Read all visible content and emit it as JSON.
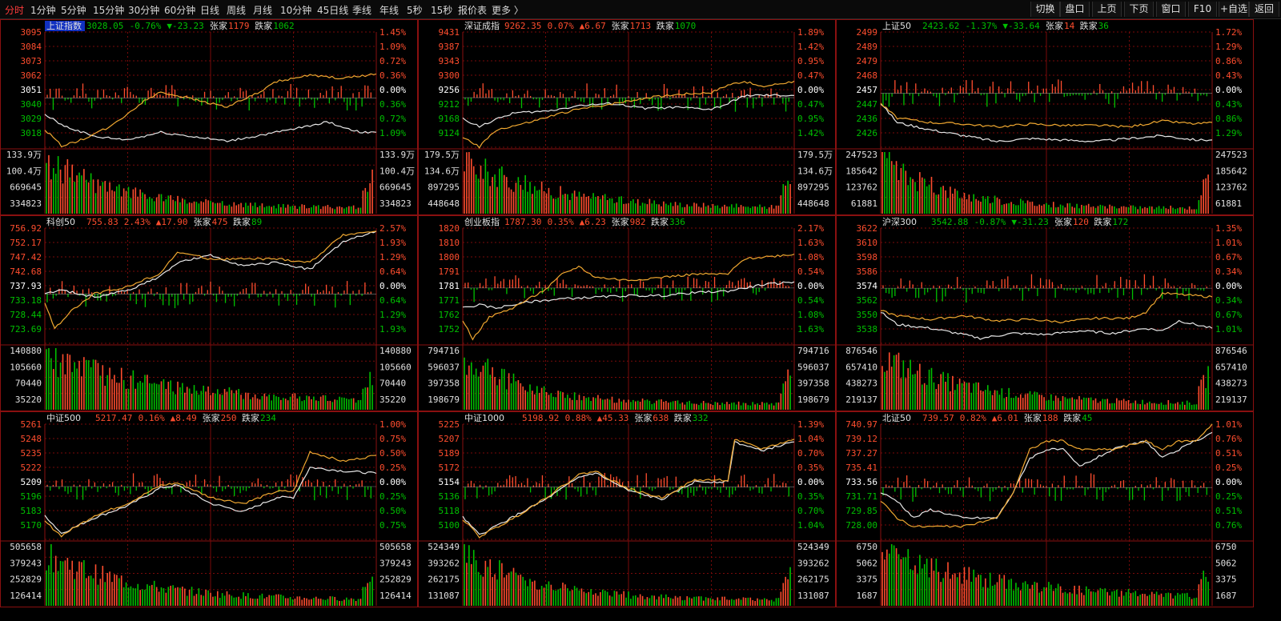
{
  "toolbar": {
    "tabs": [
      "分时",
      "1分钟",
      "5分钟",
      "15分钟",
      "30分钟",
      "60分钟",
      "日线",
      "周线",
      "月线",
      "10分钟",
      "45日线",
      "季线",
      "年线",
      "5秒",
      "15秒",
      "报价表",
      "更多 〉"
    ],
    "active_tab": "分时",
    "right_buttons": [
      "切换",
      "盘口",
      "上页",
      "下页",
      "窗口",
      "F10",
      "+自选",
      "返回"
    ]
  },
  "colors": {
    "up": "#ff4d2e",
    "down": "#00c000",
    "white_line": "#e8e8e8",
    "yellow_line": "#f0a830",
    "grid": "#7a0a0a",
    "neutral": "#ffffff"
  },
  "chart_data": [
    {
      "type": "line",
      "name": "上证指数",
      "highlight_name": true,
      "header": {
        "price": "3028.05",
        "pct": "-0.76%",
        "change": "▼-23.23",
        "rise_label": "张家",
        "rise": "1179",
        "fall_label": "跌家",
        "fall": "1062"
      },
      "price_ticks": [
        "3095",
        "3084",
        "3073",
        "3062",
        "3051",
        "3040",
        "3029",
        "3018"
      ],
      "pct_ticks": [
        "1.45%",
        "1.09%",
        "0.72%",
        "0.36%",
        "0.00%",
        "0.36%",
        "0.72%",
        "1.09%"
      ],
      "vol_ticks": [
        "133.9万",
        "100.4万",
        "669645",
        "334823"
      ],
      "ylim": [
        3018,
        3095
      ],
      "prev_close": 3051,
      "white_x": [
        0,
        5,
        15,
        25,
        35,
        45,
        55,
        65,
        75,
        85,
        95,
        100
      ],
      "white_y": [
        3040,
        3033,
        3025,
        3023,
        3028,
        3025,
        3022,
        3026,
        3030,
        3035,
        3028,
        3028
      ],
      "yellow_x": [
        0,
        5,
        10,
        20,
        30,
        35,
        45,
        55,
        65,
        70,
        80,
        90,
        100
      ],
      "yellow_y": [
        3030,
        3019,
        3022,
        3032,
        3049,
        3055,
        3050,
        3045,
        3055,
        3062,
        3066,
        3064,
        3067
      ],
      "bars_seed": 1,
      "vol_decay": 0.035
    },
    {
      "type": "line",
      "name": "深证成指",
      "header": {
        "price": "9262.35",
        "pct": "0.07%",
        "change": "▲6.67",
        "rise_label": "张家",
        "rise": "1713",
        "fall_label": "跌家",
        "fall": "1070"
      },
      "price_ticks": [
        "9431",
        "9387",
        "9343",
        "9300",
        "9256",
        "9212",
        "9168",
        "9124"
      ],
      "pct_ticks": [
        "1.89%",
        "1.42%",
        "0.95%",
        "0.47%",
        "0.00%",
        "0.47%",
        "0.95%",
        "1.42%"
      ],
      "vol_ticks": [
        "179.5万",
        "134.6万",
        "897295",
        "448648"
      ],
      "ylim": [
        9124,
        9431
      ],
      "prev_close": 9256,
      "white_x": [
        0,
        5,
        15,
        25,
        35,
        45,
        55,
        65,
        75,
        80,
        85,
        100
      ],
      "white_y": [
        9200,
        9180,
        9215,
        9220,
        9235,
        9240,
        9228,
        9230,
        9225,
        9240,
        9262,
        9262
      ],
      "yellow_x": [
        0,
        5,
        10,
        20,
        30,
        35,
        45,
        55,
        65,
        75,
        80,
        85,
        90,
        100
      ],
      "yellow_y": [
        9150,
        9125,
        9170,
        9190,
        9215,
        9225,
        9240,
        9255,
        9265,
        9270,
        9290,
        9300,
        9285,
        9300
      ],
      "bars_seed": 2,
      "vol_decay": 0.03
    },
    {
      "type": "line",
      "name": "上证50",
      "header": {
        "price": "2423.62",
        "pct": "-1.37%",
        "change": "▼-33.64",
        "rise_label": "张家",
        "rise": "14",
        "fall_label": "跌家",
        "fall": "36"
      },
      "price_ticks": [
        "2499",
        "2489",
        "2479",
        "2468",
        "2457",
        "2447",
        "2436",
        "2426"
      ],
      "pct_ticks": [
        "1.72%",
        "1.29%",
        "0.86%",
        "0.43%",
        "0.00%",
        "0.43%",
        "0.86%",
        "1.29%"
      ],
      "vol_ticks": [
        "247523",
        "185642",
        "123762",
        "61881"
      ],
      "ylim": [
        2420,
        2499
      ],
      "prev_close": 2457,
      "white_x": [
        0,
        5,
        15,
        25,
        35,
        45,
        55,
        65,
        75,
        85,
        95,
        100
      ],
      "white_y": [
        2450,
        2437,
        2432,
        2428,
        2424,
        2426,
        2425,
        2424,
        2426,
        2428,
        2425,
        2425
      ],
      "yellow_x": [
        0,
        5,
        15,
        25,
        35,
        45,
        55,
        65,
        75,
        85,
        95,
        100
      ],
      "yellow_y": [
        2450,
        2440,
        2437,
        2436,
        2434,
        2436,
        2435,
        2435,
        2434,
        2438,
        2436,
        2437
      ],
      "bars_seed": 3,
      "vol_decay": 0.04
    },
    {
      "type": "line",
      "name": "科创50",
      "header": {
        "price": "755.83",
        "pct": "2.43%",
        "change": "▲17.90",
        "rise_label": "张家",
        "rise": "475",
        "fall_label": "跌家",
        "fall": "89"
      },
      "price_ticks": [
        "756.92",
        "752.17",
        "747.42",
        "742.68",
        "737.93",
        "733.18",
        "728.44",
        "723.69"
      ],
      "pct_ticks": [
        "2.57%",
        "1.93%",
        "1.29%",
        "0.64%",
        "0.00%",
        "0.64%",
        "1.29%",
        "1.93%"
      ],
      "vol_ticks": [
        "140880",
        "105660",
        "70440",
        "35220"
      ],
      "ylim": [
        723.69,
        756.92
      ],
      "prev_close": 737.93,
      "white_x": [
        0,
        5,
        15,
        25,
        35,
        40,
        50,
        60,
        70,
        80,
        90,
        100
      ],
      "white_y": [
        738,
        739,
        737,
        739,
        743,
        747,
        749,
        746,
        747,
        745,
        753,
        756
      ],
      "yellow_x": [
        0,
        3,
        8,
        15,
        25,
        35,
        40,
        50,
        60,
        70,
        80,
        90,
        100
      ],
      "yellow_y": [
        735,
        728,
        733,
        738,
        740,
        744,
        750,
        748,
        748,
        748,
        747,
        755,
        756
      ],
      "bars_seed": 4,
      "vol_decay": 0.02
    },
    {
      "type": "line",
      "name": "创业板指",
      "header": {
        "price": "1787.30",
        "pct": "0.35%",
        "change": "▲6.23",
        "rise_label": "张家",
        "rise": "982",
        "fall_label": "跌家",
        "fall": "336"
      },
      "price_ticks": [
        "1820",
        "1810",
        "1800",
        "1791",
        "1781",
        "1771",
        "1762",
        "1752"
      ],
      "pct_ticks": [
        "2.17%",
        "1.63%",
        "1.08%",
        "0.54%",
        "0.00%",
        "0.54%",
        "1.08%",
        "1.63%"
      ],
      "vol_ticks": [
        "794716",
        "596037",
        "397358",
        "198679"
      ],
      "ylim": [
        1745,
        1820
      ],
      "prev_close": 1781,
      "white_x": [
        0,
        5,
        10,
        20,
        30,
        40,
        50,
        60,
        70,
        80,
        90,
        100
      ],
      "white_y": [
        1768,
        1770,
        1768,
        1772,
        1774,
        1775,
        1776,
        1776,
        1778,
        1779,
        1783,
        1785
      ],
      "yellow_x": [
        0,
        3,
        8,
        15,
        25,
        30,
        35,
        40,
        50,
        60,
        70,
        80,
        85,
        90,
        100
      ],
      "yellow_y": [
        1760,
        1748,
        1762,
        1768,
        1780,
        1790,
        1795,
        1788,
        1786,
        1788,
        1790,
        1790,
        1800,
        1801,
        1803
      ],
      "bars_seed": 5,
      "vol_decay": 0.04
    },
    {
      "type": "line",
      "name": "沪深300",
      "header": {
        "price": "3542.88",
        "pct": "-0.87%",
        "change": "▼-31.23",
        "rise_label": "张家",
        "rise": "120",
        "fall_label": "跌家",
        "fall": "172"
      },
      "price_ticks": [
        "3622",
        "3610",
        "3598",
        "3586",
        "3574",
        "3562",
        "3550",
        "3538"
      ],
      "pct_ticks": [
        "1.35%",
        "1.01%",
        "0.67%",
        "0.34%",
        "0.00%",
        "0.34%",
        "0.67%",
        "1.01%"
      ],
      "vol_ticks": [
        "876546",
        "657410",
        "438273",
        "219137"
      ],
      "ylim": [
        3530,
        3622
      ],
      "prev_close": 3574,
      "white_x": [
        0,
        5,
        15,
        25,
        30,
        40,
        50,
        60,
        70,
        80,
        85,
        90,
        100
      ],
      "white_y": [
        3555,
        3545,
        3542,
        3537,
        3534,
        3538,
        3537,
        3540,
        3538,
        3542,
        3540,
        3548,
        3542
      ],
      "yellow_x": [
        0,
        5,
        15,
        25,
        35,
        45,
        55,
        65,
        75,
        80,
        85,
        90,
        100
      ],
      "yellow_y": [
        3556,
        3552,
        3549,
        3552,
        3548,
        3549,
        3547,
        3550,
        3550,
        3555,
        3570,
        3569,
        3567
      ],
      "bars_seed": 6,
      "vol_decay": 0.03
    },
    {
      "type": "line",
      "name": "中证500",
      "header": {
        "price": "5217.47",
        "pct": "0.16%",
        "change": "▲8.49",
        "rise_label": "张家",
        "rise": "250",
        "fall_label": "跌家",
        "fall": "234"
      },
      "price_ticks": [
        "5261",
        "5248",
        "5235",
        "5222",
        "5209",
        "5196",
        "5183",
        "5170"
      ],
      "pct_ticks": [
        "1.00%",
        "0.75%",
        "0.50%",
        "0.25%",
        "0.00%",
        "0.25%",
        "0.50%",
        "0.75%"
      ],
      "vol_ticks": [
        "505658",
        "379243",
        "252829",
        "126414"
      ],
      "ylim": [
        5165,
        5261
      ],
      "prev_close": 5209,
      "white_x": [
        0,
        5,
        15,
        25,
        35,
        40,
        50,
        60,
        70,
        75,
        80,
        90,
        100
      ],
      "white_y": [
        5185,
        5170,
        5183,
        5193,
        5208,
        5210,
        5195,
        5188,
        5200,
        5200,
        5225,
        5222,
        5220
      ],
      "yellow_x": [
        0,
        5,
        15,
        25,
        35,
        40,
        50,
        60,
        70,
        75,
        80,
        90,
        100
      ],
      "yellow_y": [
        5180,
        5168,
        5185,
        5195,
        5210,
        5212,
        5200,
        5195,
        5205,
        5205,
        5238,
        5230,
        5235
      ],
      "bars_seed": 7,
      "vol_decay": 0.03
    },
    {
      "type": "line",
      "name": "中证1000",
      "header": {
        "price": "5198.92",
        "pct": "0.88%",
        "change": "▲45.33",
        "rise_label": "张家",
        "rise": "638",
        "fall_label": "跌家",
        "fall": "332"
      },
      "price_ticks": [
        "5225",
        "5207",
        "5189",
        "5172",
        "5154",
        "5136",
        "5118",
        "5100"
      ],
      "pct_ticks": [
        "1.39%",
        "1.04%",
        "0.70%",
        "0.35%",
        "0.00%",
        "0.35%",
        "0.70%",
        "1.04%"
      ],
      "vol_ticks": [
        "524349",
        "393262",
        "262175",
        "131087"
      ],
      "ylim": [
        5095,
        5225
      ],
      "prev_close": 5154,
      "white_x": [
        0,
        5,
        15,
        25,
        35,
        40,
        50,
        60,
        70,
        80,
        82,
        90,
        100
      ],
      "white_y": [
        5120,
        5100,
        5120,
        5140,
        5165,
        5170,
        5150,
        5140,
        5160,
        5160,
        5205,
        5195,
        5205
      ],
      "yellow_x": [
        0,
        5,
        15,
        25,
        35,
        40,
        50,
        60,
        70,
        80,
        82,
        90,
        100
      ],
      "yellow_y": [
        5118,
        5098,
        5118,
        5142,
        5168,
        5172,
        5152,
        5142,
        5162,
        5162,
        5208,
        5197,
        5208
      ],
      "bars_seed": 8,
      "vol_decay": 0.035
    },
    {
      "type": "line",
      "name": "北证50",
      "header": {
        "price": "739.57",
        "pct": "0.82%",
        "change": "▲6.01",
        "rise_label": "张家",
        "rise": "188",
        "fall_label": "跌家",
        "fall": "45"
      },
      "price_ticks": [
        "740.97",
        "739.12",
        "737.27",
        "735.41",
        "733.56",
        "731.71",
        "729.85",
        "728.00"
      ],
      "pct_ticks": [
        "1.01%",
        "0.76%",
        "0.51%",
        "0.25%",
        "0.00%",
        "0.25%",
        "0.51%",
        "0.76%"
      ],
      "vol_ticks": [
        "6750",
        "5062",
        "3375",
        "1687"
      ],
      "ylim": [
        727.5,
        740.97
      ],
      "prev_close": 733.56,
      "white_x": [
        0,
        5,
        10,
        15,
        25,
        35,
        40,
        45,
        50,
        55,
        60,
        65,
        70,
        80,
        85,
        90,
        95,
        100
      ],
      "white_y": [
        733,
        732,
        730,
        731,
        730,
        730,
        733,
        737,
        738,
        738,
        736,
        737,
        738,
        739,
        737,
        738,
        739,
        740
      ],
      "yellow_x": [
        0,
        5,
        10,
        15,
        25,
        35,
        40,
        45,
        50,
        55,
        60,
        65,
        70,
        80,
        85,
        90,
        95,
        100
      ],
      "yellow_y": [
        732,
        730,
        729,
        729,
        729,
        730,
        733,
        738,
        739,
        739,
        738,
        738,
        738,
        739,
        738,
        739,
        739,
        741
      ],
      "bars_seed": 9,
      "vol_decay": 0.02
    }
  ]
}
